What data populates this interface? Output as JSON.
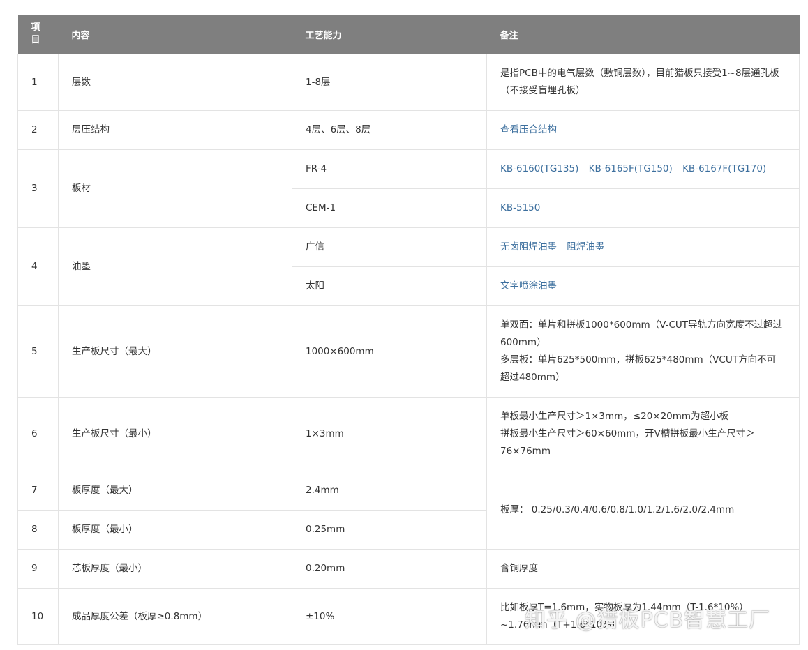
{
  "header": {
    "col1": "项目",
    "col1_line1": "项",
    "col1_line2": "目",
    "col2": "内容",
    "col3": "工艺能力",
    "col4": "备注"
  },
  "rows": [
    {
      "no": "1",
      "content": "层数",
      "capability": "1-8层",
      "note": "是指PCB中的电气层数（敷铜层数），目前猎板只接受1~8层通孔板（不接受盲埋孔板）"
    },
    {
      "no": "2",
      "content": "层压结构",
      "capability": "4层、6层、8层",
      "note": "查看压合结构"
    },
    {
      "no": "3",
      "content": "板材",
      "capability": "FR-4",
      "note_links": [
        "KB-6160(TG135)",
        "KB-6165F(TG150)",
        "KB-6167F(TG170)"
      ],
      "capability2": "CEM-1",
      "note2": "KB-5150"
    },
    {
      "no": "4",
      "content": "油墨",
      "capability": "广信",
      "note_links": [
        "无卤阻焊油墨",
        "阻焊油墨"
      ],
      "capability2": "太阳",
      "note2": "文字喷涂油墨"
    },
    {
      "no": "5",
      "content": "生产板尺寸（最大）",
      "capability": "1000×600mm",
      "note_line1": "单双面：单片和拼板1000*600mm（V-CUT导轨方向宽度不过超过600mm）",
      "note_line2": "多层板：单片625*500mm，拼板625*480mm（VCUT方向不可超过480mm）"
    },
    {
      "no": "6",
      "content": "生产板尺寸（最小）",
      "capability": "1×3mm",
      "note_line1": "单板最小生产尺寸＞1×3mm，≤20×20mm为超小板",
      "note_line2": "拼板最小生产尺寸＞60×60mm，开V槽拼板最小生产尺寸＞76×76mm"
    },
    {
      "no": "7",
      "content": "板厚度（最大）",
      "capability": "2.4mm",
      "note": "板厚： 0.25/0.3/0.4/0.6/0.8/1.0/1.2/1.6/2.0/2.4mm"
    },
    {
      "no": "8",
      "content": "板厚度（最小）",
      "capability": "0.25mm"
    },
    {
      "no": "9",
      "content": "芯板厚度（最小）",
      "capability": "0.20mm",
      "note": "含铜厚度"
    },
    {
      "no": "10",
      "content": "成品厚度公差（板厚≥0.8mm）",
      "capability": "±10%",
      "note": "比如板厚T=1.6mm，实物板厚为1.44mm（T-1.6*10%）~1.76mm（T+1.6*10%）"
    }
  ],
  "watermark": "知乎 @猎板PCB智慧工厂",
  "colors": {
    "header_bg": "#7f7f7f",
    "border": "#e3e3e3",
    "link": "#3c6f9e",
    "text": "#333333"
  }
}
